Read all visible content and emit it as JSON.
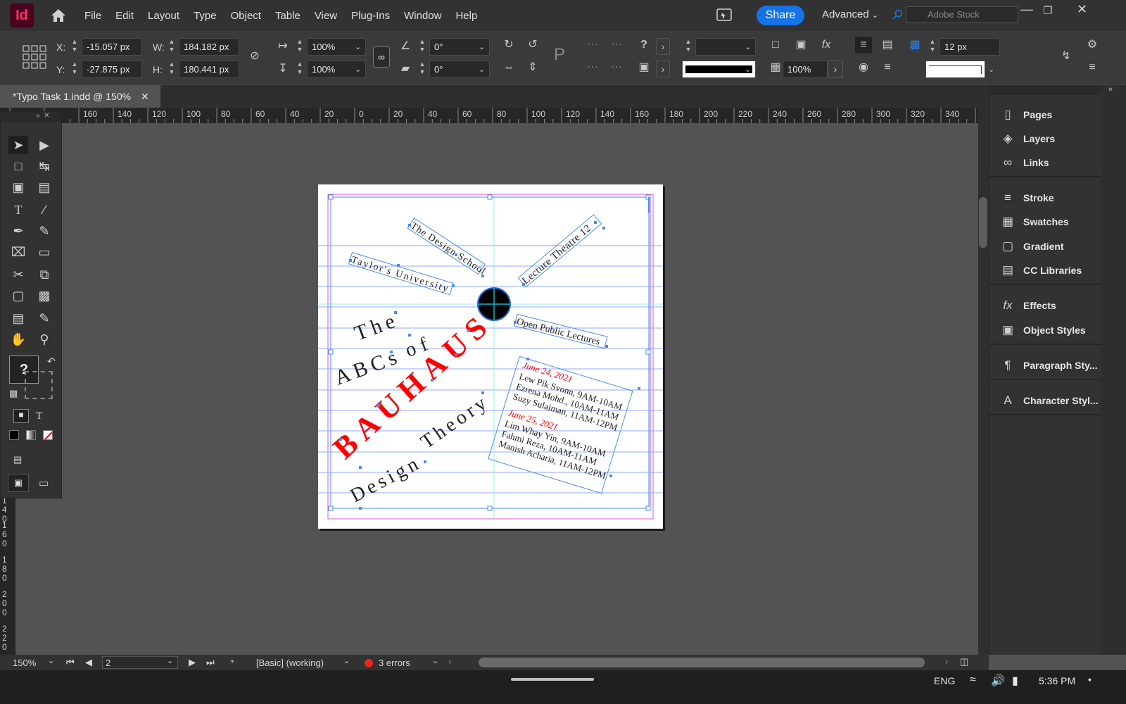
{
  "app": {
    "logo": "Id"
  },
  "menu": [
    "File",
    "Edit",
    "Layout",
    "Type",
    "Object",
    "Table",
    "View",
    "Plug-Ins",
    "Window",
    "Help"
  ],
  "topbar": {
    "share": "Share",
    "workspace": "Advanced",
    "search_placeholder": "Adobe Stock"
  },
  "control": {
    "x_label": "X:",
    "x": "-15.057 px",
    "y_label": "Y:",
    "y": "-27.875 px",
    "w_label": "W:",
    "w": "184.182 px",
    "h_label": "H:",
    "h": "180.441 px",
    "scale_x": "100%",
    "scale_y": "100%",
    "rotate": "0°",
    "shear": "0°",
    "opacity": "100%",
    "stroke_weight": "12 px"
  },
  "document": {
    "tab": "*Typo Task 1.indd @ 150%"
  },
  "ruler_h": [
    "160",
    "140",
    "120",
    "100",
    "80",
    "60",
    "40",
    "20",
    "0",
    "20",
    "40",
    "60",
    "80",
    "100",
    "120",
    "140",
    "160",
    "180",
    "200",
    "220",
    "240",
    "260",
    "280",
    "300",
    "320",
    "340"
  ],
  "ruler_v": [
    "140",
    "160",
    "180",
    "200",
    "220"
  ],
  "artwork": {
    "t_design_school": "The Design School",
    "t_taylors": "Taylor's University",
    "t_lecture": "Lecture Theatre 12",
    "t_open": "Open Public Lectures",
    "t_the": "The",
    "t_of": "of",
    "t_abcs": "ABCs",
    "t_bauhaus": "BAUHAUS",
    "t_design": "Design",
    "t_theory": "Theory",
    "date1": "June 24, 2021",
    "d1_l1": "Lew Pik Svonn, 9AM-10AM",
    "d1_l2": "Ezrena Mohd., 10AM-11AM",
    "d1_l3": "Suzy Sulaiman, 11AM-12PM",
    "date2": "June 25, 2021",
    "d2_l1": "Lim Whay Yin, 9AM-10AM",
    "d2_l2": "Fahmi Reza, 10AM-11AM",
    "d2_l3": "Manish Acharia, 11AM-12PM"
  },
  "panels": [
    "Pages",
    "Layers",
    "Links",
    "Stroke",
    "Swatches",
    "Gradient",
    "CC Libraries",
    "Effects",
    "Object Styles",
    "Paragraph Sty...",
    "Character Styl..."
  ],
  "status": {
    "zoom": "150%",
    "page": "2",
    "style": "[Basic] (working)",
    "errors": "3 errors"
  },
  "taskbar": {
    "lang": "ENG",
    "time": "5:36 PM"
  },
  "colors": {
    "accent": "#1473e6",
    "error": "#e8251f",
    "bauhaus_red": "#ff0000",
    "selection": "#2d7de6"
  }
}
